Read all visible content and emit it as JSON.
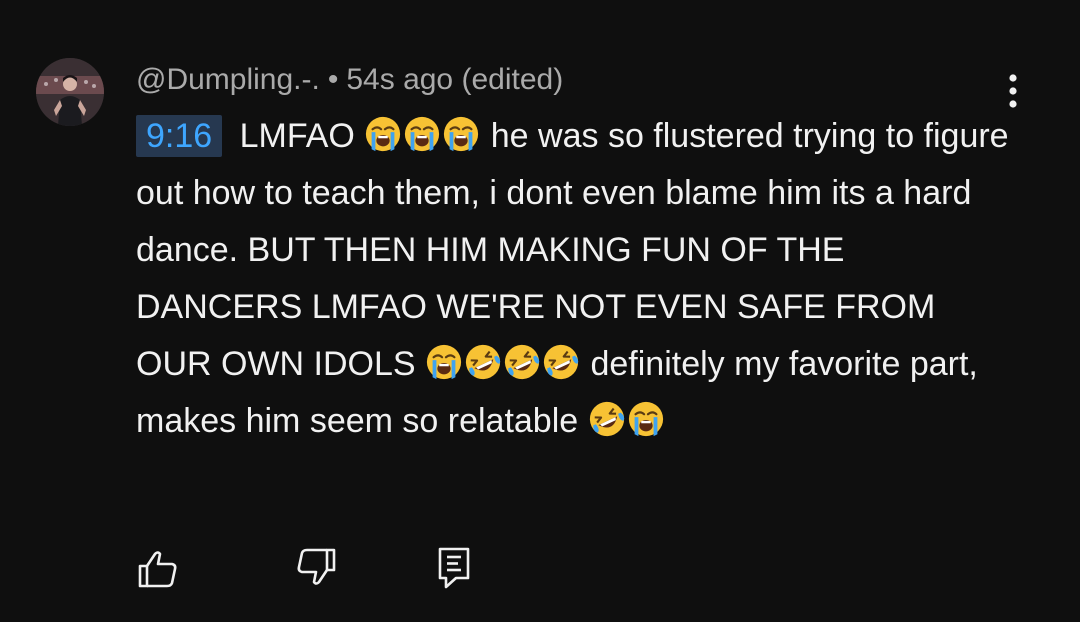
{
  "comment": {
    "author": "@Dumpling.-.",
    "separator": "•",
    "time": "54s ago",
    "edited": "(edited)",
    "timestamp_link": "9:16",
    "text_segments": [
      " LMFAO ",
      " he was so flustered trying to figure out how to teach them, i dont even blame him its a hard dance. BUT THEN HIM MAKING FUN OF THE DANCERS LMFAO WE'RE NOT EVEN SAFE FROM OUR OWN IDOLS ",
      " definitely my favorite part, makes him seem so relatable "
    ]
  },
  "icons": {
    "avatar": "avatar",
    "menu": "more-vertical-icon",
    "like": "thumbs-up-icon",
    "dislike": "thumbs-down-icon",
    "reply": "reply-comment-icon",
    "emoji_cry": "loudly-crying-face-emoji",
    "emoji_laugh": "rolling-on-floor-laughing-emoji"
  },
  "colors": {
    "background": "#0f0f0f",
    "text": "#f1f1f1",
    "meta": "#aaaaaa",
    "timestamp_link": "#3ea6ff",
    "timestamp_bg": "#263850"
  }
}
